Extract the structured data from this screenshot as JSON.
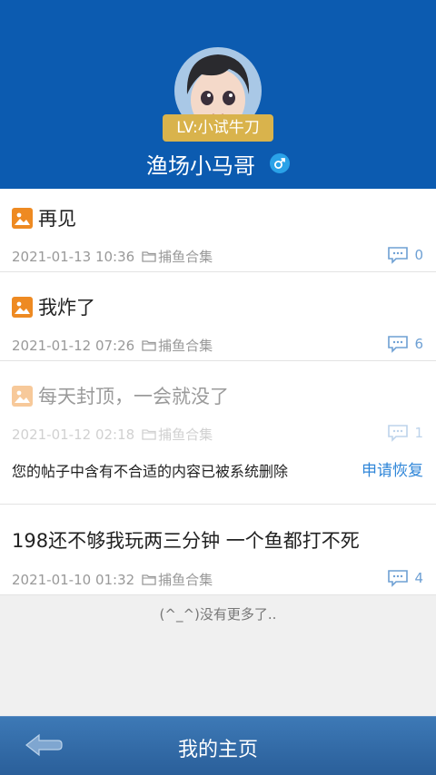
{
  "profile": {
    "level": "LV:小试牛刀",
    "username": "渔场小马哥",
    "gender_icon": "male-icon"
  },
  "posts": [
    {
      "title": "再见",
      "datetime": "2021-01-13 10:36",
      "category": "捕鱼合集",
      "comments": "0"
    },
    {
      "title": "我炸了",
      "datetime": "2021-01-12 07:26",
      "category": "捕鱼合集",
      "comments": "6"
    },
    {
      "title": "每天封顶，一会就没了",
      "datetime": "2021-01-12 02:18",
      "category": "捕鱼合集",
      "comments": "1",
      "deleted_note": "您的帖子中含有不合适的内容已被系统删除",
      "restore_label": "申请恢复"
    },
    {
      "title": "198还不够我玩两三分钟 一个鱼都打不死",
      "datetime": "2021-01-10 01:32",
      "category": "捕鱼合集",
      "comments": "4"
    }
  ],
  "list_end_text": "(^_^)没有更多了..",
  "footer": {
    "title": "我的主页",
    "back_icon": "back-arrow-icon"
  },
  "colors": {
    "header": "#0c5bb0",
    "badge": "#d9b34c",
    "accent": "#2f86d8",
    "footer": "#2a5f9a",
    "image_icon": "#ee8a22"
  }
}
